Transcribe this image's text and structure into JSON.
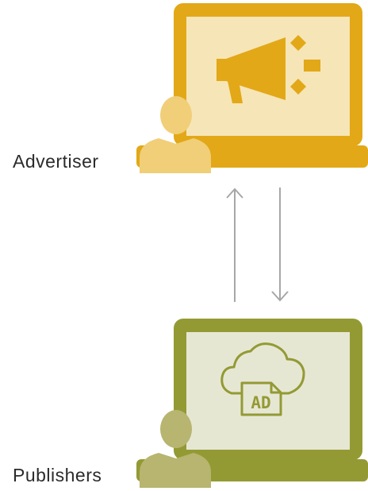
{
  "roles": {
    "advertiser": "Advertiser",
    "publishers": "Publishers"
  },
  "ad_badge_text": "AD",
  "colors": {
    "advertiser_frame": "#E2A817",
    "advertiser_screen": "#F6E5B6",
    "advertiser_person": "#F1CE78",
    "publisher_frame": "#939A34",
    "publisher_screen": "#E6E7D3",
    "publisher_person": "#B7B56F",
    "arrow": "#A7A7A7"
  },
  "icons": {
    "advertiser_screen_icon": "megaphone-icon",
    "publisher_screen_icon": "cloud-ad-icon"
  }
}
